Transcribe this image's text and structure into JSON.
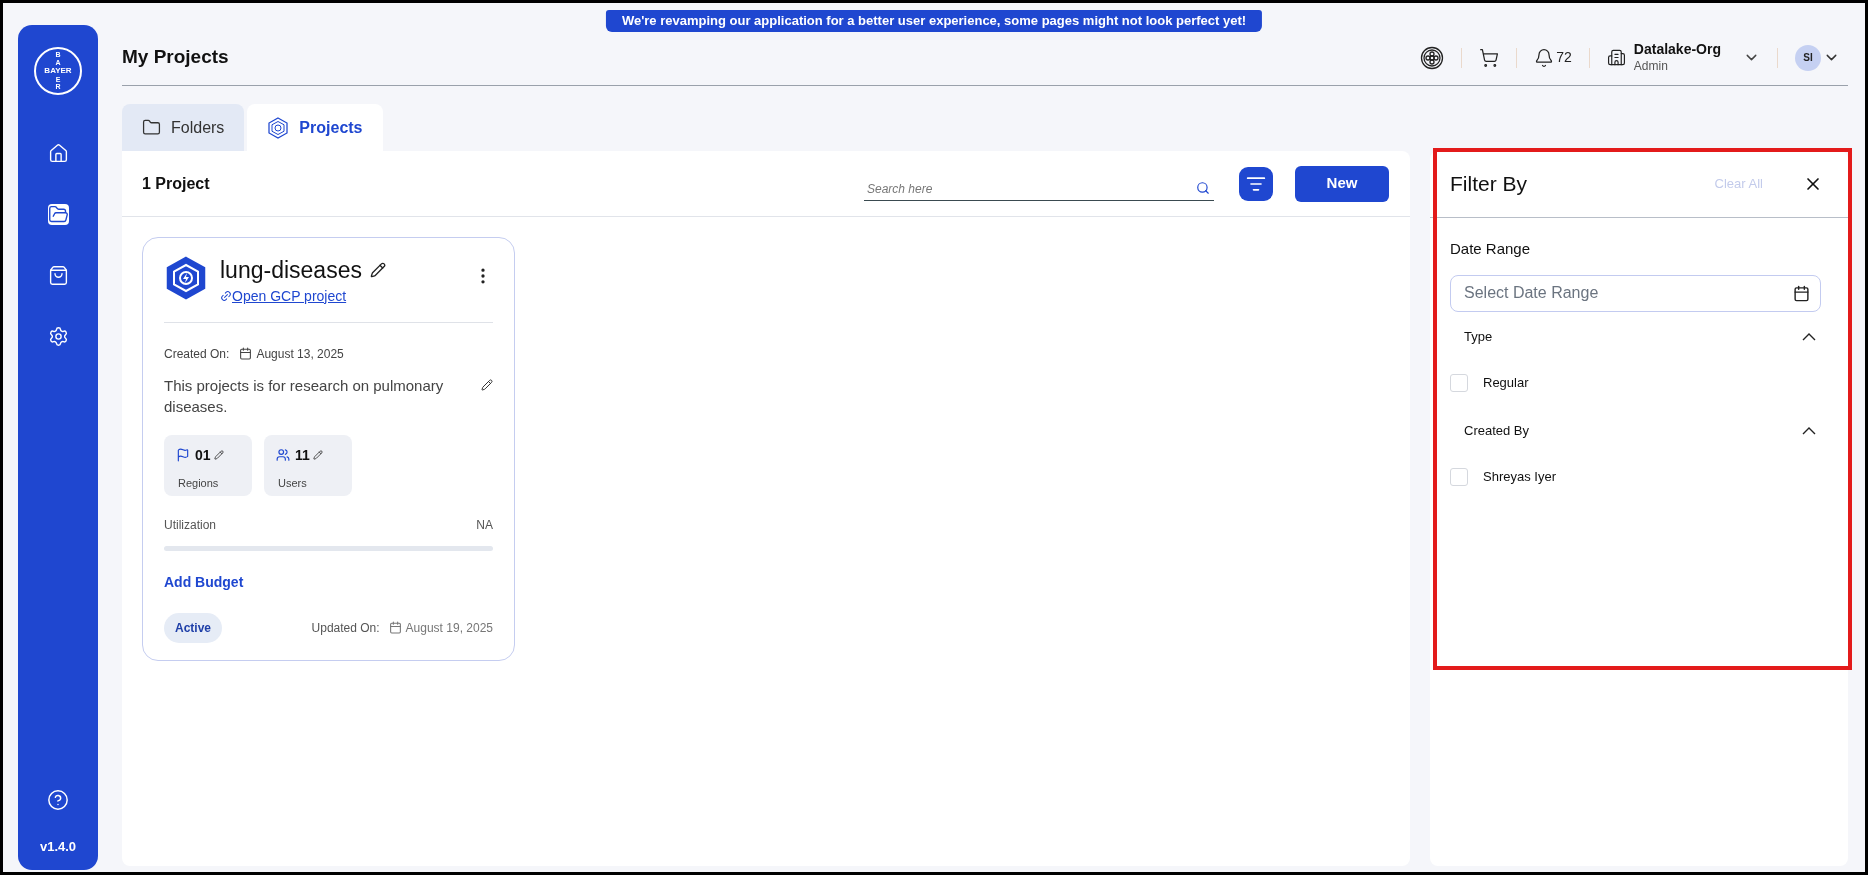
{
  "banner": "We're revamping our application for a better user experience, some pages might not look perfect yet!",
  "sidebar": {
    "logo": {
      "horizontal": "BAYER",
      "vertical_top": "BA",
      "vertical_bottom": "ER"
    },
    "items": [
      {
        "kind": "home",
        "selected": false
      },
      {
        "kind": "folder",
        "selected": true
      },
      {
        "kind": "bag",
        "selected": false
      },
      {
        "kind": "settings",
        "selected": false
      }
    ],
    "version": "v1.4.0"
  },
  "header": {
    "title": "My Projects",
    "notifications": "72",
    "org": {
      "name": "Datalake-Org",
      "role": "Admin"
    },
    "avatar": "SI"
  },
  "tabs": [
    {
      "label": "Folders",
      "kind": "folder",
      "selected": false
    },
    {
      "label": "Projects",
      "kind": "project",
      "selected": true
    }
  ],
  "toolbar": {
    "count": "1 Project",
    "search": {
      "placeholder": "Search here"
    },
    "new_button": "New"
  },
  "projects": [
    {
      "name": "lung-diseases",
      "link": "Open GCP project",
      "created_label": "Created On:",
      "created_date": "August 13, 2025",
      "description": "This projects is for research on pulmonary diseases.",
      "stats": [
        {
          "kind": "regions",
          "value": "01",
          "label": "Regions"
        },
        {
          "kind": "users",
          "value": "11",
          "label": "Users"
        }
      ],
      "utilization": {
        "label": "Utilization",
        "reading": "NA"
      },
      "add_budget": "Add Budget",
      "status": "Active",
      "updated_label": "Updated On:",
      "updated_date": "August 19, 2025"
    }
  ],
  "filter": {
    "title": "Filter By",
    "clear": {
      "label": "Clear All",
      "disabled": true
    },
    "date_range": {
      "label": "Date Range",
      "placeholder": "Select Date Range"
    },
    "sections": [
      {
        "title": "Type",
        "expanded": true,
        "options": [
          {
            "label": "Regular",
            "checked": false
          }
        ]
      },
      {
        "title": "Created By",
        "expanded": true,
        "options": [
          {
            "label": "Shreyas Iyer",
            "checked": false
          }
        ]
      }
    ]
  }
}
